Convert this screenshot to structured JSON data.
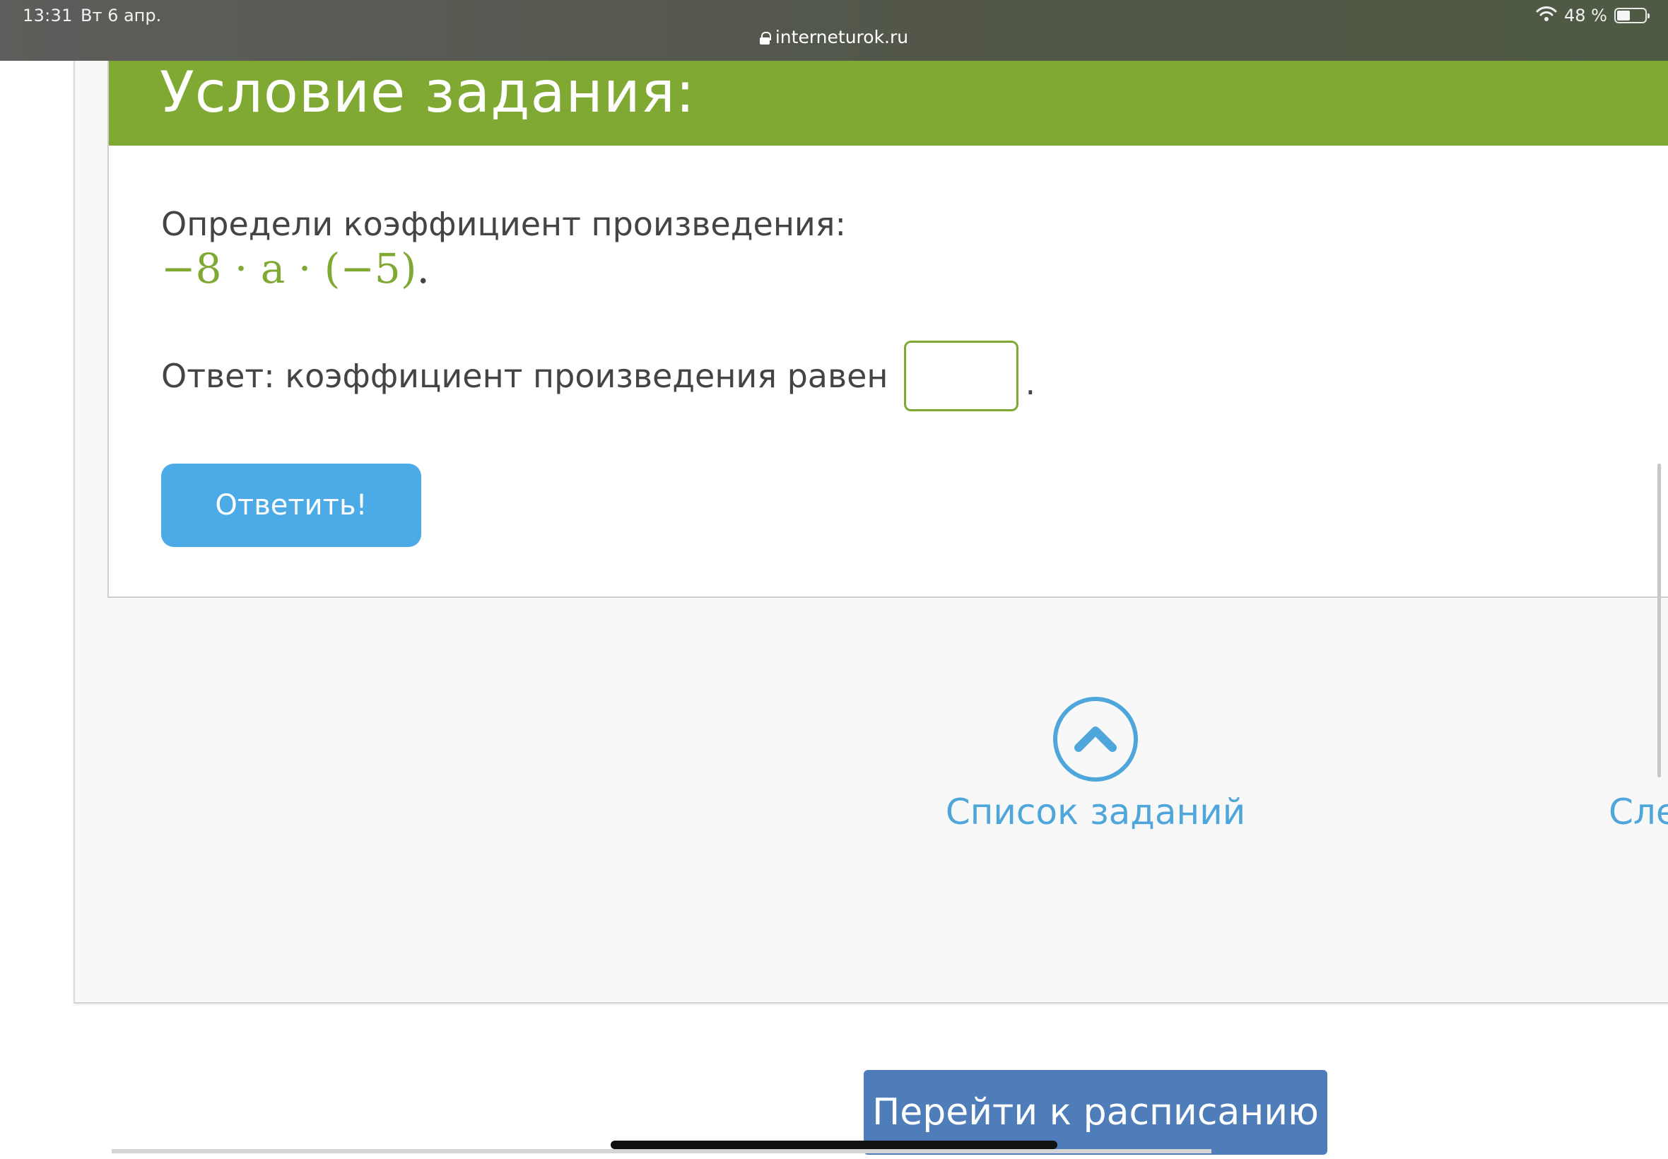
{
  "status_bar": {
    "time": "13:31",
    "date": "Вт 6 апр.",
    "battery_percent": "48 %",
    "battery_level": 0.48,
    "url": "interneturok.ru"
  },
  "task": {
    "title": "Условие задания:",
    "question": "Определи коэффициент произведения:",
    "expression": "−8 · a · (−5)",
    "expression_end": ".",
    "answer_prefix": "Ответ: коэффициент произведения равен",
    "answer_value": "",
    "answer_suffix": ".",
    "submit_label": "Ответить!"
  },
  "navigation": {
    "task_list_label": "Список заданий",
    "next_label": "Сле"
  },
  "schedule_button_label": "Перейти к расписанию",
  "colors": {
    "header_green": "#80a934",
    "button_blue": "#4caae7",
    "link_blue": "#4ea6db",
    "schedule_blue": "#4e7dba"
  }
}
